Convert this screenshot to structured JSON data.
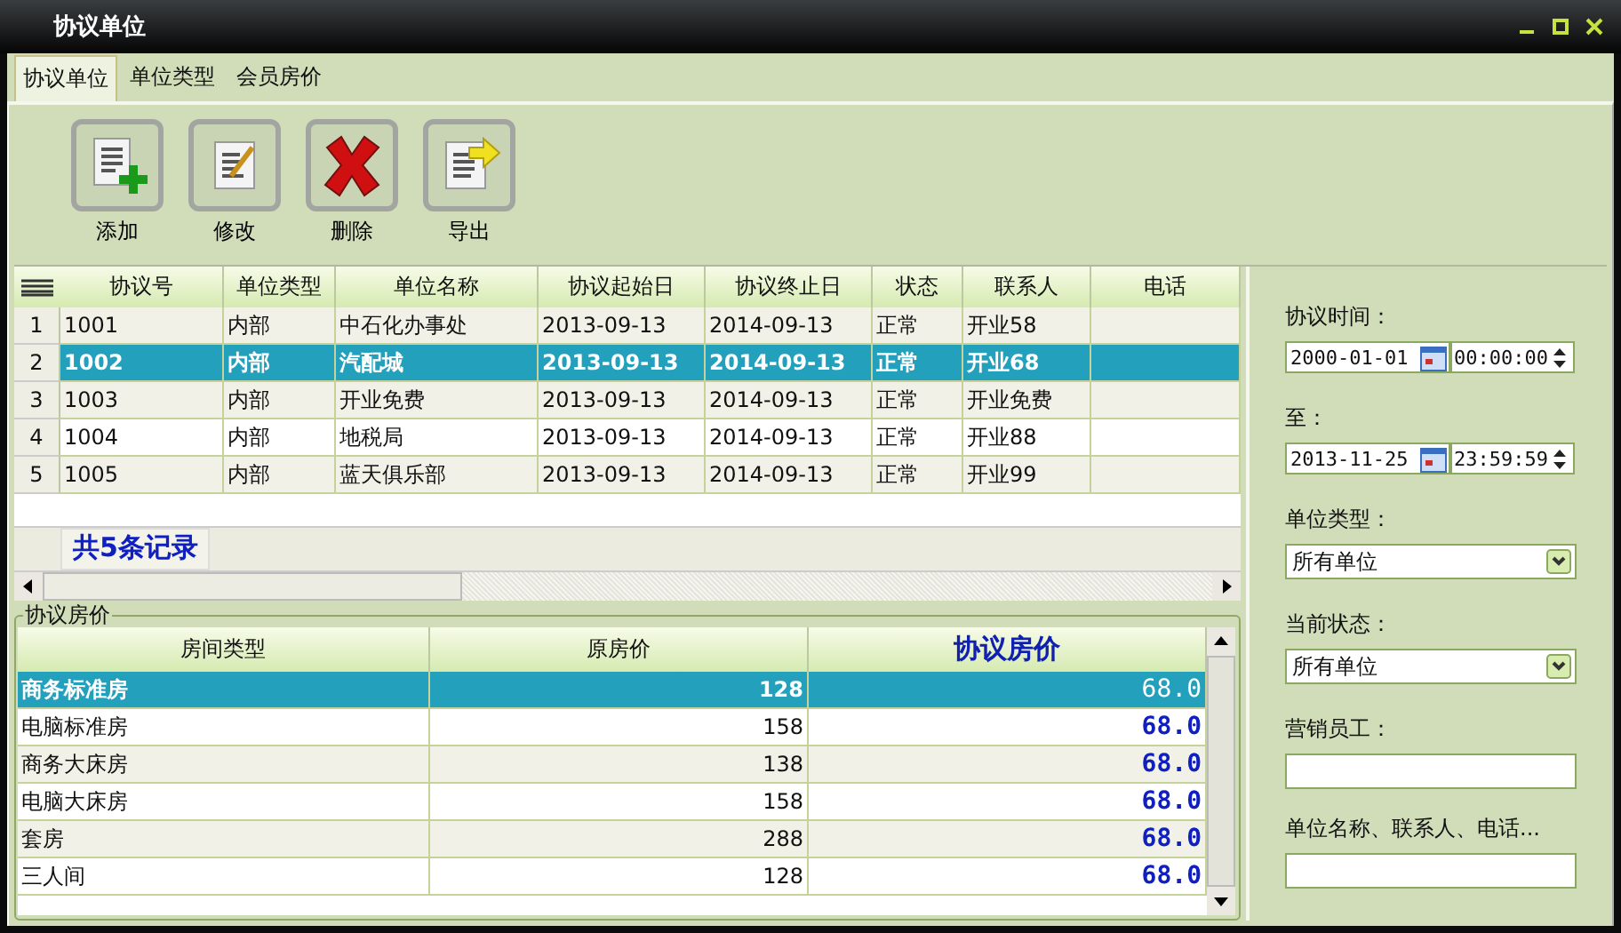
{
  "window": {
    "title": "协议单位"
  },
  "tabs": [
    {
      "label": "协议单位",
      "selected": true
    },
    {
      "label": "单位类型",
      "selected": false
    },
    {
      "label": "会员房价",
      "selected": false
    }
  ],
  "toolbar": [
    {
      "kind": "add",
      "label": "添加"
    },
    {
      "kind": "edit",
      "label": "修改"
    },
    {
      "kind": "delete",
      "label": "删除"
    },
    {
      "kind": "export",
      "label": "导出"
    }
  ],
  "units_table": {
    "columns": [
      "协议号",
      "单位类型",
      "单位名称",
      "协议起始日",
      "协议终止日",
      "状态",
      "联系人",
      "电话"
    ],
    "rows": [
      {
        "number": "1",
        "selected": false,
        "cells": [
          "1001",
          "内部",
          "中石化办事处",
          "2013-09-13",
          "2014-09-13",
          "正常",
          "开业58",
          ""
        ]
      },
      {
        "number": "2",
        "selected": true,
        "cells": [
          "1002",
          "内部",
          "汽配城",
          "2013-09-13",
          "2014-09-13",
          "正常",
          "开业68",
          ""
        ]
      },
      {
        "number": "3",
        "selected": false,
        "cells": [
          "1003",
          "内部",
          "开业免费",
          "2013-09-13",
          "2014-09-13",
          "正常",
          "开业免费",
          ""
        ]
      },
      {
        "number": "4",
        "selected": false,
        "cells": [
          "1004",
          "内部",
          "地税局",
          "2013-09-13",
          "2014-09-13",
          "正常",
          "开业88",
          ""
        ]
      },
      {
        "number": "5",
        "selected": false,
        "cells": [
          "1005",
          "内部",
          "蓝天俱乐部",
          "2013-09-13",
          "2014-09-13",
          "正常",
          "开业99",
          ""
        ]
      }
    ],
    "footer": "共5条记录"
  },
  "price_section": {
    "title": "协议房价",
    "columns": [
      "房间类型",
      "原房价",
      "协议房价"
    ],
    "rows": [
      {
        "room_type": "商务标准房",
        "original_price": "128",
        "agreed_price": "68.0",
        "selected": true
      },
      {
        "room_type": "电脑标准房",
        "original_price": "158",
        "agreed_price": "68.0",
        "selected": false
      },
      {
        "room_type": "商务大床房",
        "original_price": "138",
        "agreed_price": "68.0",
        "selected": false
      },
      {
        "room_type": "电脑大床房",
        "original_price": "158",
        "agreed_price": "68.0",
        "selected": false
      },
      {
        "room_type": "套房",
        "original_price": "288",
        "agreed_price": "68.0",
        "selected": false
      },
      {
        "room_type": "三人间",
        "original_price": "128",
        "agreed_price": "68.0",
        "selected": false
      }
    ]
  },
  "filters": {
    "from_label": "协议时间：",
    "from_date": "2000-01-01",
    "from_time": "00:00:00",
    "to_label": "至：",
    "to_date": "2013-11-25",
    "to_time": "23:59:59",
    "unit_type_label": "单位类型：",
    "unit_type_value": "所有单位",
    "status_label": "当前状态：",
    "status_value": "所有单位",
    "staff_label": "营销员工：",
    "search_label": "单位名称、联系人、电话..."
  }
}
